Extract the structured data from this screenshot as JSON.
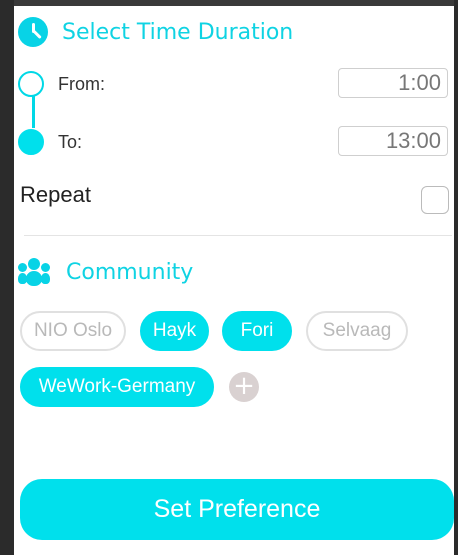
{
  "time_section": {
    "title": "Select Time Duration",
    "icon": "clock-icon",
    "from": {
      "label": "From:",
      "value": "1:00"
    },
    "to": {
      "label": "To:",
      "value": "13:00"
    }
  },
  "repeat": {
    "label": "Repeat",
    "checked": false
  },
  "community": {
    "title": "Community",
    "icon": "people-icon",
    "chips": [
      {
        "label": "NIO Oslo",
        "selected": false
      },
      {
        "label": "Hayk",
        "selected": true
      },
      {
        "label": "Fori",
        "selected": true
      },
      {
        "label": "Selvaag",
        "selected": false
      },
      {
        "label": "WeWork-Germany",
        "selected": true
      }
    ],
    "add_label": "+"
  },
  "cta": {
    "label": "Set Preference"
  },
  "colors": {
    "accent": "#00e0ec",
    "chip_off_border": "#e0e0e0",
    "add_button": "#d9d1d1"
  }
}
